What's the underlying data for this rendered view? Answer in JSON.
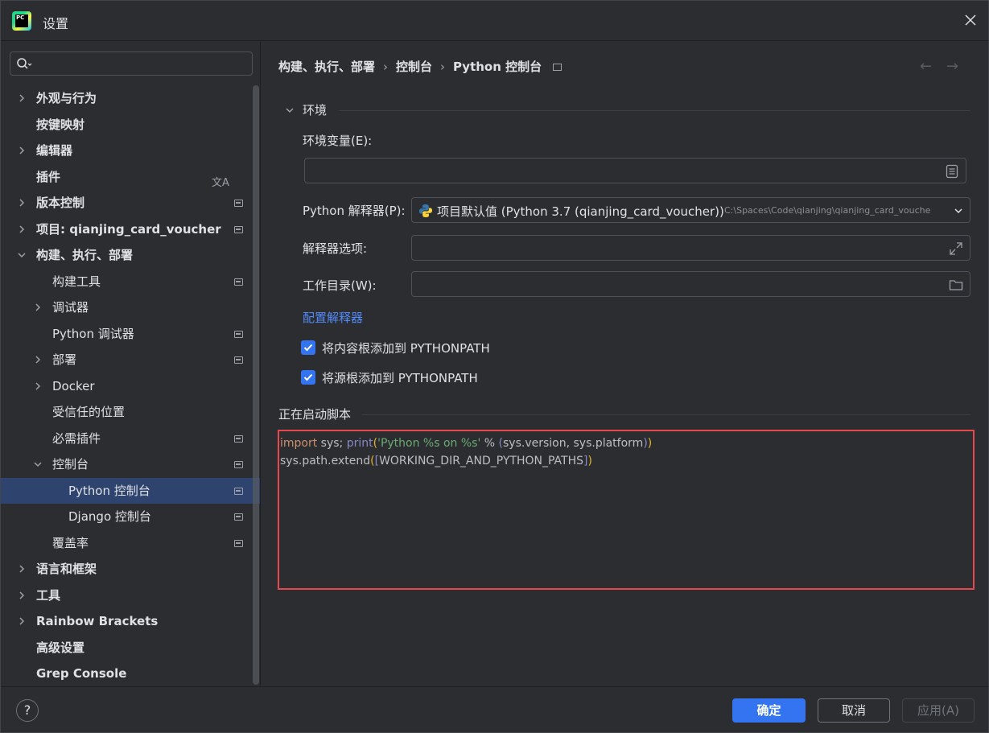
{
  "window": {
    "title": "设置",
    "logo_text": "PC"
  },
  "search": {
    "placeholder": "",
    "value": ""
  },
  "sidebar": {
    "items": [
      {
        "label": "外观与行为",
        "indent": 0,
        "chevron": "right",
        "bold": true,
        "mark": false
      },
      {
        "label": "按键映射",
        "indent": 0,
        "chevron": "none",
        "bold": true,
        "mark": false
      },
      {
        "label": "编辑器",
        "indent": 0,
        "chevron": "right",
        "bold": true,
        "mark": false
      },
      {
        "label": "插件",
        "indent": 0,
        "chevron": "none",
        "bold": true,
        "mark": false,
        "translate": true
      },
      {
        "label": "版本控制",
        "indent": 0,
        "chevron": "right",
        "bold": true,
        "mark": true
      },
      {
        "label": "项目: qianjing_card_voucher",
        "indent": 0,
        "chevron": "right",
        "bold": true,
        "mark": true
      },
      {
        "label": "构建、执行、部署",
        "indent": 0,
        "chevron": "down",
        "bold": true,
        "mark": false
      },
      {
        "label": "构建工具",
        "indent": 1,
        "chevron": "none",
        "bold": false,
        "mark": true
      },
      {
        "label": "调试器",
        "indent": 1,
        "chevron": "right",
        "bold": false,
        "mark": false
      },
      {
        "label": "Python 调试器",
        "indent": 1,
        "chevron": "none",
        "bold": false,
        "mark": true
      },
      {
        "label": "部署",
        "indent": 1,
        "chevron": "right",
        "bold": false,
        "mark": true
      },
      {
        "label": "Docker",
        "indent": 1,
        "chevron": "right",
        "bold": false,
        "mark": false
      },
      {
        "label": "受信任的位置",
        "indent": 1,
        "chevron": "none",
        "bold": false,
        "mark": false
      },
      {
        "label": "必需插件",
        "indent": 1,
        "chevron": "none",
        "bold": false,
        "mark": true
      },
      {
        "label": "控制台",
        "indent": 1,
        "chevron": "down",
        "bold": false,
        "mark": true
      },
      {
        "label": "Python 控制台",
        "indent": 2,
        "chevron": "none",
        "bold": false,
        "mark": true,
        "selected": true
      },
      {
        "label": "Django 控制台",
        "indent": 2,
        "chevron": "none",
        "bold": false,
        "mark": true
      },
      {
        "label": "覆盖率",
        "indent": 1,
        "chevron": "none",
        "bold": false,
        "mark": true
      },
      {
        "label": "语言和框架",
        "indent": 0,
        "chevron": "right",
        "bold": true,
        "mark": false
      },
      {
        "label": "工具",
        "indent": 0,
        "chevron": "right",
        "bold": true,
        "mark": false
      },
      {
        "label": "Rainbow Brackets",
        "indent": 0,
        "chevron": "right",
        "bold": true,
        "mark": false
      },
      {
        "label": "高级设置",
        "indent": 0,
        "chevron": "none",
        "bold": true,
        "mark": false
      },
      {
        "label": "Grep Console",
        "indent": 0,
        "chevron": "none",
        "bold": true,
        "mark": false
      }
    ]
  },
  "breadcrumb": {
    "items": [
      "构建、执行、部署",
      "控制台",
      "Python 控制台"
    ],
    "separator": "›"
  },
  "nav": {
    "back": "←",
    "forward": "→"
  },
  "environment": {
    "section_title": "环境",
    "env_vars_label": "环境变量(E):",
    "env_vars_value": "",
    "interpreter_label": "Python 解释器(P):",
    "interpreter_value": "项目默认值 (Python 3.7 (qianjing_card_voucher))",
    "interpreter_path": "C:\\Spaces\\Code\\qianjing\\qianjing_card_vouche",
    "interpreter_options_label": "解释器选项:",
    "interpreter_options_value": "",
    "workdir_label": "工作目录(W):",
    "workdir_value": "",
    "configure_link": "配置解释器",
    "checkbox_content_roots": {
      "label": "将内容根添加到 PYTHONPATH",
      "checked": true
    },
    "checkbox_source_roots": {
      "label": "将源根添加到 PYTHONPATH",
      "checked": true
    }
  },
  "startup_script": {
    "section_title": "正在启动脚本",
    "line1": {
      "kw": "import",
      "plain1": " sys; ",
      "fn": "print",
      "paren_open": "(",
      "str": "'Python %s on %s'",
      "plain2": " % ",
      "paren2_open": "(",
      "plain3": "sys.version, sys.platform",
      "paren2_close": ")",
      "paren_close": ")"
    },
    "line2": {
      "plain1": "sys.path.extend",
      "paren_open": "(",
      "brk_open": "[",
      "plain2": "WORKING_DIR_AND_PYTHON_PATHS",
      "brk_close": "]",
      "paren_close": ")"
    }
  },
  "footer": {
    "help": "?",
    "ok": "确定",
    "cancel": "取消",
    "apply": "应用(A)"
  },
  "colors": {
    "accent": "#3574f0",
    "highlight_border": "#e5484d",
    "selected_row": "#2e436e",
    "link": "#548af7"
  }
}
